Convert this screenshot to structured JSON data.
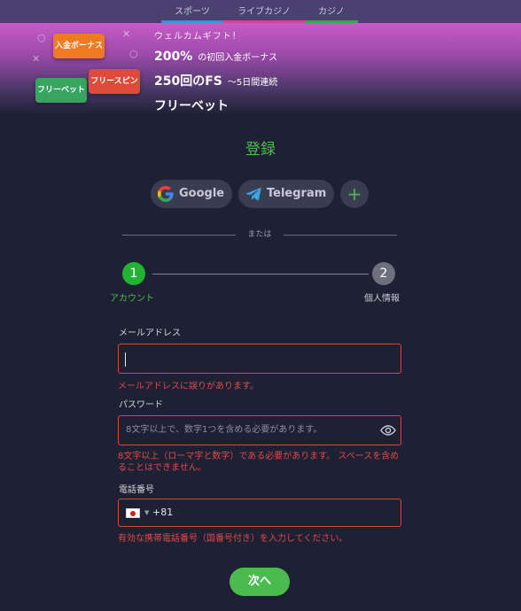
{
  "tabs": [
    {
      "label": "スポーツ",
      "color": "#3a8fe0"
    },
    {
      "label": "ライブカジノ",
      "color": "#e0408a"
    },
    {
      "label": "カジノ",
      "color": "#3aa84a"
    }
  ],
  "promo": {
    "tiles": {
      "deposit": "入金ボーナス",
      "freebet": "フリーベット",
      "freespin": "フリースピン"
    },
    "welcome": "ウェルカムギフト！",
    "line1_big": "200%",
    "line1_small": "の初回入金ボーナス",
    "line2_big": "250回のFS",
    "line2_small": "〜5日間連続",
    "line3": "フリーベット"
  },
  "form": {
    "title": "登録",
    "social": {
      "google": "Google",
      "telegram": "Telegram",
      "more": "+"
    },
    "divider": "または",
    "steps": [
      {
        "number": "1",
        "label": "アカウント",
        "active": true
      },
      {
        "number": "2",
        "label": "個人情報",
        "active": false
      }
    ],
    "email": {
      "label": "メールアドレス",
      "value": "",
      "error": "メールアドレスに誤りがあります。"
    },
    "password": {
      "label": "パスワード",
      "placeholder": "8文字以上で、数字1つを含める必要があります。",
      "error": "8文字以上（ローマ字と数字）である必要があります。 スペースを含めることはできません。"
    },
    "phone": {
      "label": "電話番号",
      "country": "JP",
      "dial_code": "+81",
      "error": "有効な携帯電話番号（国番号付き）を入力してください。"
    },
    "next": "次へ"
  },
  "colors": {
    "accent": "#4cbb4f",
    "error": "#e04444",
    "background": "#1e2033"
  }
}
